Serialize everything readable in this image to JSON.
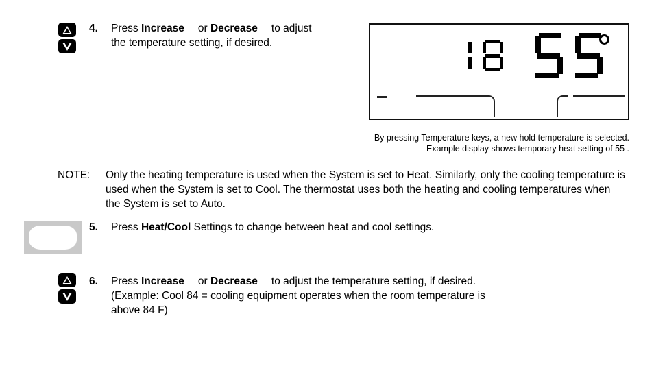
{
  "steps": [
    {
      "number": "4.",
      "icon_up": "increase-arrow-key",
      "icon_down": "decrease-arrow-key",
      "line1_pre": "Press ",
      "line1_b1": "Increase",
      "line1_mid": "or ",
      "line1_b2": "Decrease",
      "line1_post": "to adjust",
      "line2": "the temperature setting, if desired."
    },
    {
      "number": "5.",
      "icon": "heat-cool-settings-key",
      "line1_pre": "Press ",
      "line1_b1": "Heat/Cool",
      "line1_post": " Settings to change between heat and cool settings."
    },
    {
      "number": "6.",
      "icon_up": "increase-arrow-key",
      "icon_down": "decrease-arrow-key",
      "line1_pre": "Press ",
      "line1_b1": "Increase",
      "line1_mid": "or ",
      "line1_b2": "Decrease",
      "line1_post": "to adjust the temperature setting, if desired.",
      "line2": "(Example: Cool 84  = cooling equipment  operates when the room temperature is",
      "line3": "above 84 F)"
    }
  ],
  "note": {
    "label": "NOTE:",
    "body": "Only the heating temperature is used when the System is set to Heat. Similarly, only the cooling temperature is used when the System is set to Cool. The thermostat uses both the heating and cooling temperatures when the System is set to Auto."
  },
  "display": {
    "name": "thermostat-lcd",
    "small_value": "18",
    "large_value": "55",
    "degree_symbol": "°",
    "segment_color": "#000000",
    "background": "#ffffff",
    "border_color": "#111111"
  },
  "caption": {
    "line1": "By pressing Temperature keys, a new hold temperature is selected.",
    "line2": "Example display shows temporary heat setting of 55 ."
  }
}
